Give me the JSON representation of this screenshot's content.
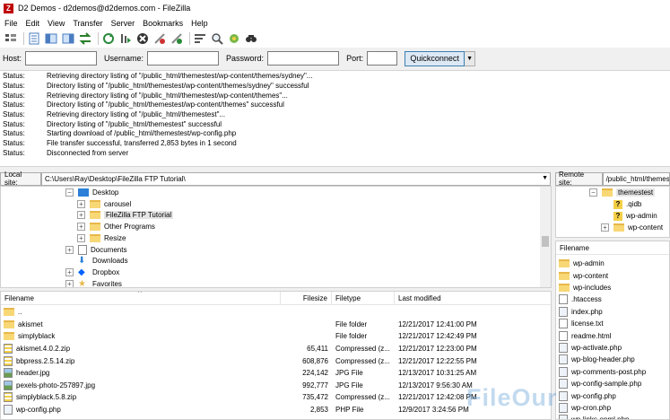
{
  "window": {
    "title": "D2 Demos - d2demos@d2demos.com - FileZilla",
    "app_icon": "Z"
  },
  "menu": [
    "File",
    "Edit",
    "View",
    "Transfer",
    "Server",
    "Bookmarks",
    "Help"
  ],
  "toolbar": {
    "icons": [
      "site-manager-icon",
      "toggle-log-icon",
      "toggle-local-tree-icon",
      "toggle-remote-tree-icon",
      "toggle-queue-icon",
      "refresh-icon",
      "process-queue-icon",
      "cancel-icon",
      "disconnect-icon",
      "reconnect-icon",
      "filter-icon",
      "compare-icon",
      "sync-browse-icon",
      "search-icon"
    ]
  },
  "quickconnect": {
    "host_label": "Host:",
    "username_label": "Username:",
    "password_label": "Password:",
    "port_label": "Port:",
    "host_value": "",
    "username_value": "",
    "password_value": "",
    "port_value": "",
    "button_label": "Quickconnect",
    "dropdown_glyph": "▼"
  },
  "log": [
    {
      "type": "Status:",
      "msg": "Retrieving directory listing of \"/public_html/themestest/wp-content/themes/sydney\"..."
    },
    {
      "type": "Status:",
      "msg": "Directory listing of \"/public_html/themestest/wp-content/themes/sydney\" successful"
    },
    {
      "type": "Status:",
      "msg": "Retrieving directory listing of \"/public_html/themestest/wp-content/themes\"..."
    },
    {
      "type": "Status:",
      "msg": "Directory listing of \"/public_html/themestest/wp-content/themes\" successful"
    },
    {
      "type": "Status:",
      "msg": "Retrieving directory listing of \"/public_html/themestest\"..."
    },
    {
      "type": "Status:",
      "msg": "Directory listing of \"/public_html/themestest\" successful"
    },
    {
      "type": "Status:",
      "msg": "Starting download of /public_html/themestest/wp-config.php"
    },
    {
      "type": "Status:",
      "msg": "File transfer successful, transferred 2,853 bytes in 1 second"
    },
    {
      "type": "Status:",
      "msg": "Disconnected from server"
    }
  ],
  "local": {
    "site_label": "Local site:",
    "path": "C:\\Users\\Ray\\Desktop\\FileZilla FTP Tutorial\\",
    "tree": [
      {
        "label": "Desktop",
        "expander": "−",
        "icon": "desktop",
        "level": 0
      },
      {
        "label": "carousel",
        "expander": "+",
        "icon": "folder",
        "level": 1
      },
      {
        "label": "FileZilla FTP Tutorial",
        "expander": "+",
        "icon": "folder",
        "level": 1,
        "selected": true
      },
      {
        "label": "Other Programs",
        "expander": "+",
        "icon": "folder",
        "level": 1
      },
      {
        "label": "Resize",
        "expander": "+",
        "icon": "folder",
        "level": 1
      },
      {
        "label": "Documents",
        "expander": "+",
        "icon": "documents",
        "level": 0
      },
      {
        "label": "Downloads",
        "expander": "",
        "icon": "downloads",
        "level": 0
      },
      {
        "label": "Dropbox",
        "expander": "+",
        "icon": "dropbox",
        "level": 0
      },
      {
        "label": "Favorites",
        "expander": "+",
        "icon": "star",
        "level": 0
      }
    ],
    "columns": [
      "Filename",
      "Filesize",
      "Filetype",
      "Last modified"
    ],
    "sort_glyph": "^",
    "files": [
      {
        "name": "..",
        "size": "",
        "type": "",
        "modified": "",
        "icon": "folder"
      },
      {
        "name": "akismet",
        "size": "",
        "type": "File folder",
        "modified": "12/21/2017 12:41:00 PM",
        "icon": "folder"
      },
      {
        "name": "simplyblack",
        "size": "",
        "type": "File folder",
        "modified": "12/21/2017 12:42:49 PM",
        "icon": "folder"
      },
      {
        "name": "akismet.4.0.2.zip",
        "size": "65,411",
        "type": "Compressed (z...",
        "modified": "12/21/2017 12:23:00 PM",
        "icon": "zip"
      },
      {
        "name": "bbpress.2.5.14.zip",
        "size": "608,876",
        "type": "Compressed (z...",
        "modified": "12/21/2017 12:22:55 PM",
        "icon": "zip"
      },
      {
        "name": "header.jpg",
        "size": "224,142",
        "type": "JPG File",
        "modified": "12/13/2017 10:31:25 AM",
        "icon": "img"
      },
      {
        "name": "pexels-photo-257897.jpg",
        "size": "992,777",
        "type": "JPG File",
        "modified": "12/13/2017 9:56:30 AM",
        "icon": "img"
      },
      {
        "name": "simplyblack.5.8.zip",
        "size": "735,472",
        "type": "Compressed (z...",
        "modified": "12/21/2017 12:42:08 PM",
        "icon": "zip"
      },
      {
        "name": "wp-config.php",
        "size": "2,853",
        "type": "PHP File",
        "modified": "12/9/2017 3:24:56 PM",
        "icon": "php"
      }
    ]
  },
  "remote": {
    "site_label": "Remote site:",
    "path": "/public_html/themestest",
    "tree": [
      {
        "label": "themestest",
        "expander": "−",
        "icon": "folder",
        "level": 0,
        "selected": true
      },
      {
        "label": ".qidb",
        "expander": "",
        "icon": "question",
        "level": 1
      },
      {
        "label": "wp-admin",
        "expander": "",
        "icon": "question",
        "level": 1
      },
      {
        "label": "wp-content",
        "expander": "+",
        "icon": "folder",
        "level": 1
      }
    ],
    "columns": [
      "Filename"
    ],
    "files": [
      {
        "name": "wp-admin",
        "icon": "folder"
      },
      {
        "name": "wp-content",
        "icon": "folder"
      },
      {
        "name": "wp-includes",
        "icon": "folder"
      },
      {
        "name": ".htaccess",
        "icon": "file"
      },
      {
        "name": "index.php",
        "icon": "php"
      },
      {
        "name": "license.txt",
        "icon": "file"
      },
      {
        "name": "readme.html",
        "icon": "file"
      },
      {
        "name": "wp-activate.php",
        "icon": "php"
      },
      {
        "name": "wp-blog-header.php",
        "icon": "php"
      },
      {
        "name": "wp-comments-post.php",
        "icon": "php"
      },
      {
        "name": "wp-config-sample.php",
        "icon": "php"
      },
      {
        "name": "wp-config.php",
        "icon": "php"
      },
      {
        "name": "wp-cron.php",
        "icon": "php"
      },
      {
        "name": "wp-links-opml.php",
        "icon": "php"
      }
    ]
  },
  "watermark": "FileOur"
}
